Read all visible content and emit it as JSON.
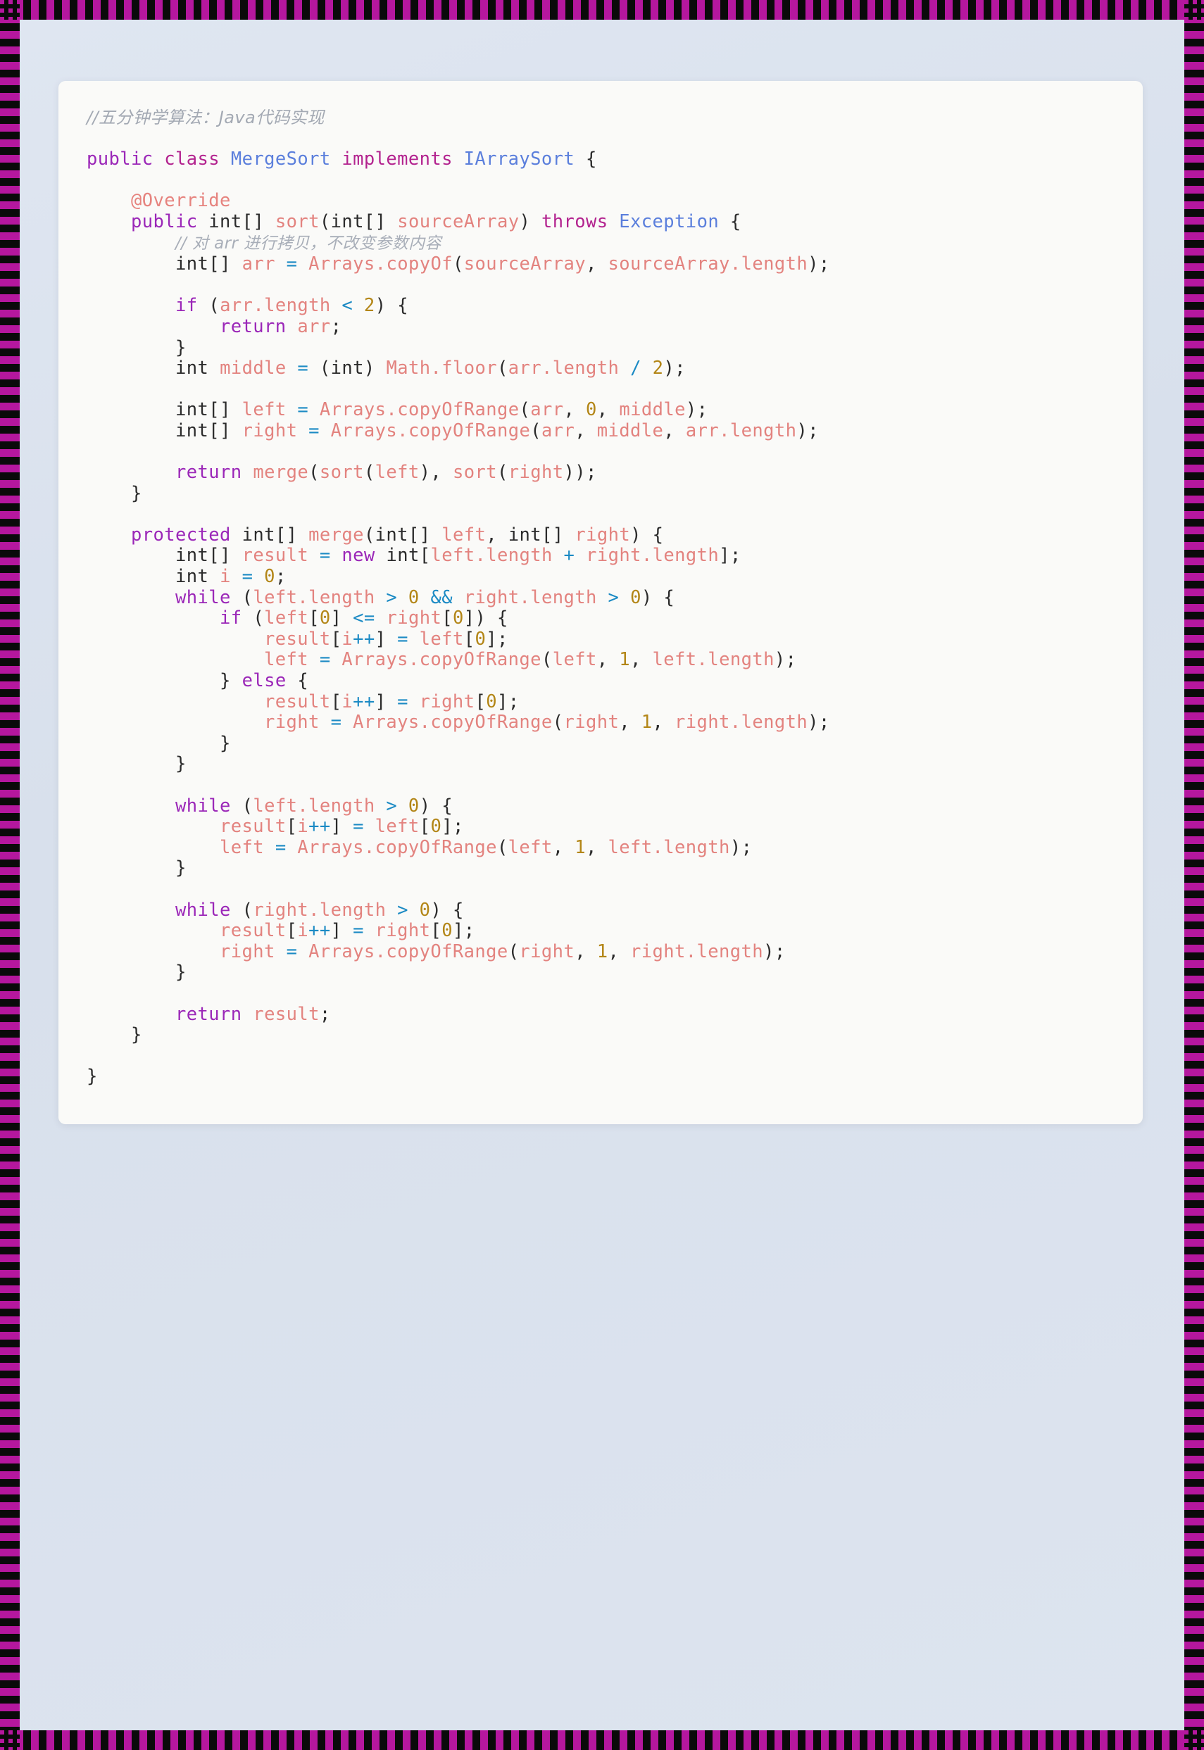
{
  "theme": {
    "frame_color": "#b5179e",
    "frame_dark": "#0a0a0a",
    "page_background": "#dde4ef",
    "card_background": "#fafaf8",
    "keyword_color": "#b3238f",
    "keyword2_color": "#9b27b8",
    "type_color": "#5b7fdc",
    "identifier_color": "#e3837f",
    "primitive_color": "#2b2b2b",
    "operator_color": "#1b8ac4",
    "number_color": "#b38617",
    "comment_color": "#a3a9b3",
    "annotation_color": "#e6837e"
  },
  "code": {
    "language": "Java",
    "header_comment": "//五分钟学算法：Java代码实现",
    "class_name": "MergeSort",
    "interface_name": "IArraySort",
    "inline_comment": "// 对 arr 进行拷贝，不改变参数内容",
    "annotation": "@Override",
    "lines": [
      {
        "n": 1,
        "t": "header_comment"
      },
      {
        "n": 2,
        "t": "blank"
      },
      {
        "n": 3,
        "t": "class_decl"
      },
      {
        "n": 4,
        "t": "blank"
      },
      {
        "n": 5,
        "t": "annotation"
      },
      {
        "n": 6,
        "t": "sort_signature"
      },
      {
        "n": 7,
        "t": "inline_comment"
      },
      {
        "n": 8,
        "t": "copy_of"
      },
      {
        "n": 9,
        "t": "blank"
      },
      {
        "n": 10,
        "t": "if_len_lt_2"
      },
      {
        "n": 11,
        "t": "return_arr"
      },
      {
        "n": 12,
        "t": "close_brace"
      },
      {
        "n": 13,
        "t": "middle_decl"
      },
      {
        "n": 14,
        "t": "blank"
      },
      {
        "n": 15,
        "t": "left_decl"
      },
      {
        "n": 16,
        "t": "right_decl"
      },
      {
        "n": 17,
        "t": "blank"
      },
      {
        "n": 18,
        "t": "return_merge"
      },
      {
        "n": 19,
        "t": "close_brace"
      },
      {
        "n": 20,
        "t": "blank"
      },
      {
        "n": 21,
        "t": "merge_signature"
      },
      {
        "n": 22,
        "t": "result_decl"
      },
      {
        "n": 23,
        "t": "i_decl"
      },
      {
        "n": 24,
        "t": "while_both"
      },
      {
        "n": 25,
        "t": "if_left_le_right"
      },
      {
        "n": 26,
        "t": "result_left"
      },
      {
        "n": 27,
        "t": "left_shift"
      },
      {
        "n": 28,
        "t": "else"
      },
      {
        "n": 29,
        "t": "result_right"
      },
      {
        "n": 30,
        "t": "right_shift"
      },
      {
        "n": 31,
        "t": "close_brace"
      },
      {
        "n": 32,
        "t": "close_brace"
      },
      {
        "n": 33,
        "t": "blank"
      },
      {
        "n": 34,
        "t": "while_left"
      },
      {
        "n": 35,
        "t": "result_left"
      },
      {
        "n": 36,
        "t": "left_shift"
      },
      {
        "n": 37,
        "t": "close_brace"
      },
      {
        "n": 38,
        "t": "blank"
      },
      {
        "n": 39,
        "t": "while_right"
      },
      {
        "n": 40,
        "t": "result_right"
      },
      {
        "n": 41,
        "t": "right_shift"
      },
      {
        "n": 42,
        "t": "close_brace"
      },
      {
        "n": 43,
        "t": "blank"
      },
      {
        "n": 44,
        "t": "return_result"
      },
      {
        "n": 45,
        "t": "close_brace"
      },
      {
        "n": 46,
        "t": "blank"
      },
      {
        "n": 47,
        "t": "close_brace_outer"
      }
    ],
    "text": {
      "l1": "//五分钟学算法：Java代码实现",
      "l3": "public class MergeSort implements IArraySort {",
      "l5": "    @Override",
      "l6": "    public int[] sort(int[] sourceArray) throws Exception {",
      "l7": "        // 对 arr 进行拷贝，不改变参数内容",
      "l8": "        int[] arr = Arrays.copyOf(sourceArray, sourceArray.length);",
      "l10": "        if (arr.length < 2) {",
      "l11": "            return arr;",
      "l12": "        }",
      "l13": "        int middle = (int) Math.floor(arr.length / 2);",
      "l15": "        int[] left = Arrays.copyOfRange(arr, 0, middle);",
      "l16": "        int[] right = Arrays.copyOfRange(arr, middle, arr.length);",
      "l18": "        return merge(sort(left), sort(right));",
      "l19": "    }",
      "l21": "    protected int[] merge(int[] left, int[] right) {",
      "l22": "        int[] result = new int[left.length + right.length];",
      "l23": "        int i = 0;",
      "l24": "        while (left.length > 0 && right.length > 0) {",
      "l25": "            if (left[0] <= right[0]) {",
      "l26": "                result[i++] = left[0];",
      "l27": "                left = Arrays.copyOfRange(left, 1, left.length);",
      "l28": "            } else {",
      "l29": "                result[i++] = right[0];",
      "l30": "                right = Arrays.copyOfRange(right, 1, right.length);",
      "l31": "            }",
      "l32": "        }",
      "l34": "        while (left.length > 0) {",
      "l35": "            result[i++] = left[0];",
      "l36": "            left = Arrays.copyOfRange(left, 1, left.length);",
      "l37": "        }",
      "l39": "        while (right.length > 0) {",
      "l40": "            result[i++] = right[0];",
      "l41": "            right = Arrays.copyOfRange(right, 1, right.length);",
      "l42": "        }",
      "l44": "        return result;",
      "l45": "    }",
      "l47": "}"
    }
  }
}
